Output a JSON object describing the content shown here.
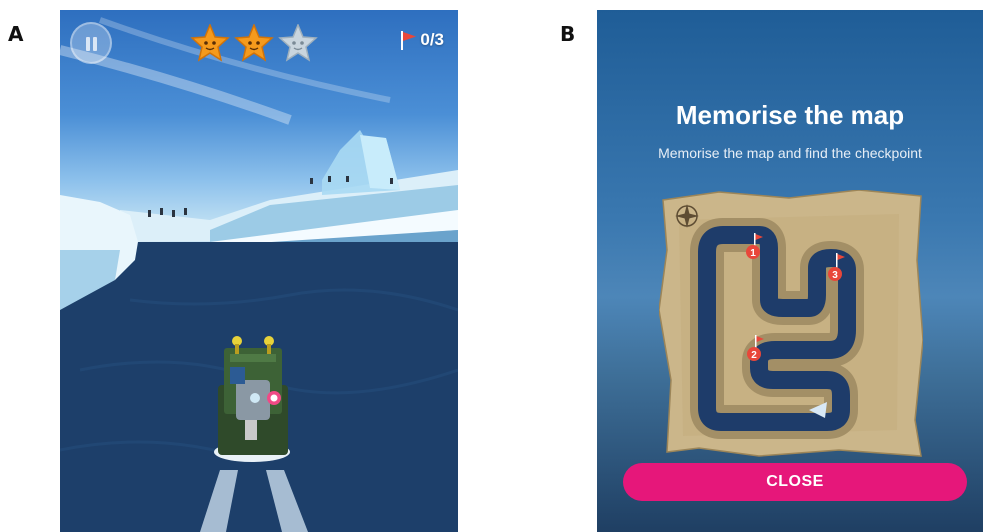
{
  "panels": {
    "a": {
      "label": "A"
    },
    "b": {
      "label": "B"
    }
  },
  "game": {
    "stars": {
      "earned": 2,
      "total": 3
    },
    "flag_counter": "0/3",
    "pause_icon": "pause-icon"
  },
  "map_screen": {
    "title": "Memorise the map",
    "subtitle": "Memorise the map and find the checkpoint",
    "checkpoints": [
      "1",
      "2",
      "3"
    ],
    "close_label": "CLOSE"
  },
  "colors": {
    "accent": "#e6177a",
    "star_gold": "#f59a1c",
    "flag_red": "#e8473a",
    "water": "#1d3f6a"
  }
}
